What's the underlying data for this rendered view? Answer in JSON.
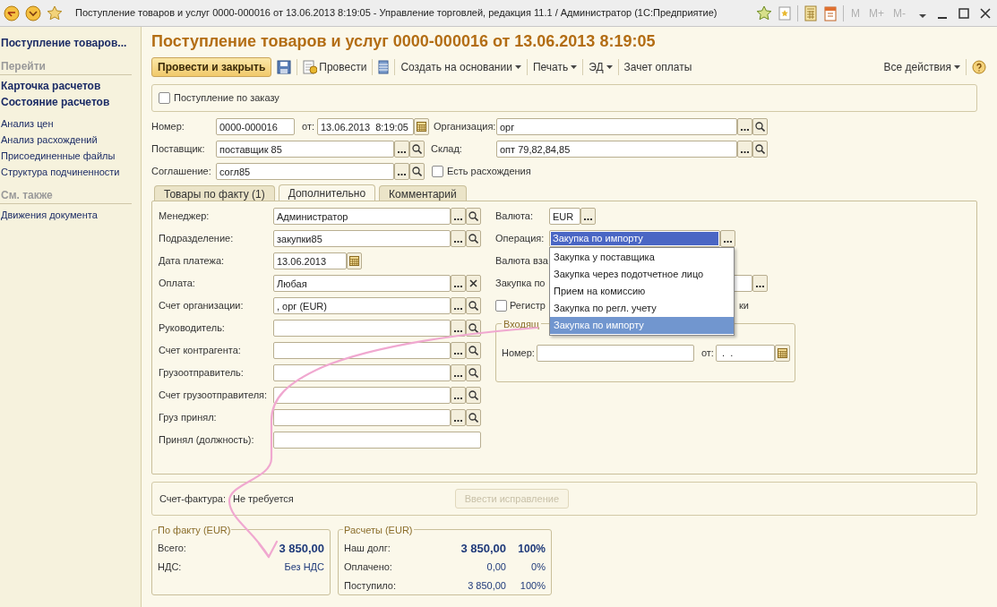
{
  "window": {
    "title": "Поступление товаров и услуг 0000-000016 от 13.06.2013 8:19:05 - Управление торговлей, редакция 11.1 / Администратор  (1С:Предприятие)",
    "memory_keys": [
      "M",
      "M+",
      "M-"
    ]
  },
  "sidebar": {
    "title": "Поступление товаров...",
    "sections": [
      {
        "heading": "Перейти",
        "items": [
          {
            "label": "Карточка расчетов",
            "bold": true
          },
          {
            "label": "Состояние расчетов",
            "bold": true
          },
          {
            "label": "Анализ цен",
            "bold": false
          },
          {
            "label": "Анализ расхождений",
            "bold": false
          },
          {
            "label": "Присоединенные файлы",
            "bold": false
          },
          {
            "label": "Структура подчиненности",
            "bold": false
          }
        ]
      },
      {
        "heading": "См. также",
        "items": [
          {
            "label": "Движения документа",
            "bold": false
          }
        ]
      }
    ]
  },
  "form": {
    "title": "Поступление товаров и услуг 0000-000016 от 13.06.2013 8:19:05",
    "toolbar": [
      {
        "kind": "primary",
        "label": "Провести и закрыть"
      },
      {
        "kind": "save"
      },
      {
        "kind": "post",
        "label": "Провести"
      },
      {
        "kind": "list"
      },
      {
        "kind": "menu",
        "label": "Создать на основании"
      },
      {
        "kind": "menu",
        "label": "Печать"
      },
      {
        "kind": "menu",
        "label": "ЭД"
      },
      {
        "kind": "link",
        "label": "Зачет оплаты"
      }
    ],
    "all_actions": "Все действия",
    "order_checkbox": {
      "label": "Поступление по заказу",
      "checked": false
    },
    "number": {
      "label": "Номер:",
      "value": "0000-000016"
    },
    "date": {
      "label": "от:",
      "value": "13.06.2013  8:19:05"
    },
    "organization": {
      "label": "Организация:",
      "value": "орг"
    },
    "supplier": {
      "label": "Поставщик:",
      "value": "поставщик 85"
    },
    "warehouse": {
      "label": "Склад:",
      "value": "опт 79,82,84,85"
    },
    "agreement": {
      "label": "Соглашение:",
      "value": "согл85"
    },
    "discrepancy_checkbox": {
      "label": "Есть расхождения",
      "checked": false
    },
    "tabs": [
      {
        "label": "Товары по факту (1)",
        "selected": false
      },
      {
        "label": "Дополнительно",
        "selected": true
      },
      {
        "label": "Комментарий",
        "selected": false
      }
    ],
    "fields": [
      {
        "label": "Менеджер:",
        "value": "Администратор",
        "kind": "select"
      },
      {
        "label": "Подразделение:",
        "value": "закупки85",
        "kind": "select"
      },
      {
        "label": "Дата платежа:",
        "value": "13.06.2013",
        "kind": "date"
      },
      {
        "label": "Оплата:",
        "value": "Любая",
        "kind": "clear"
      },
      {
        "label": "Счет организации:",
        "value": ", орг (EUR)",
        "kind": "select"
      },
      {
        "label": "Руководитель:",
        "kind": "select"
      },
      {
        "label": "Счет контрагента:",
        "kind": "select"
      },
      {
        "label": "Грузоотправитель:",
        "kind": "select"
      },
      {
        "label": "Счет грузоотправителя:",
        "kind": "select"
      },
      {
        "label": "Груз принял:",
        "kind": "select"
      },
      {
        "label": "Принял (должность):",
        "kind": "plain"
      }
    ],
    "currency": {
      "label": "Валюта:",
      "value": "EUR"
    },
    "operation": {
      "label": "Операция:",
      "value": "Закупка по импорту",
      "options": [
        {
          "label": "Закупка у поставщика",
          "selected": false
        },
        {
          "label": "Закупка через подотчетное лицо",
          "selected": false
        },
        {
          "label": "Прием на комиссию",
          "selected": false
        },
        {
          "label": "Закупка по регл. учету",
          "selected": false
        },
        {
          "label": "Закупка по импорту",
          "selected": true
        }
      ]
    },
    "cut_label_1": "Валюта вза",
    "cut_label_2": "Закупка по",
    "cut_checkbox": {
      "label": "Регистр",
      "tail": "ки",
      "checked": false
    },
    "incoming": {
      "legend": "Входящ",
      "number_label": "Номер:",
      "date_label": "от:",
      "date_value": " .  ."
    },
    "invoice": {
      "label": "Счет-фактура:",
      "value": "Не требуется",
      "button": "Ввести исправление",
      "button_disabled": true
    },
    "fact": {
      "legend": "По факту (EUR)",
      "rows": [
        {
          "label": "Всего:",
          "value": "3 850,00",
          "bold": true
        },
        {
          "label": "НДС:",
          "value": "Без НДС",
          "bold": false
        }
      ]
    },
    "settlements": {
      "legend": "Расчеты (EUR)",
      "rows": [
        {
          "label": "Наш долг:",
          "value": "3 850,00",
          "percent": "100%",
          "bold": true
        },
        {
          "label": "Оплачено:",
          "value": "0,00",
          "percent": "0%",
          "bold": false
        },
        {
          "label": "Поступило:",
          "value": "3 850,00",
          "percent": "100%",
          "bold": false
        }
      ]
    }
  }
}
